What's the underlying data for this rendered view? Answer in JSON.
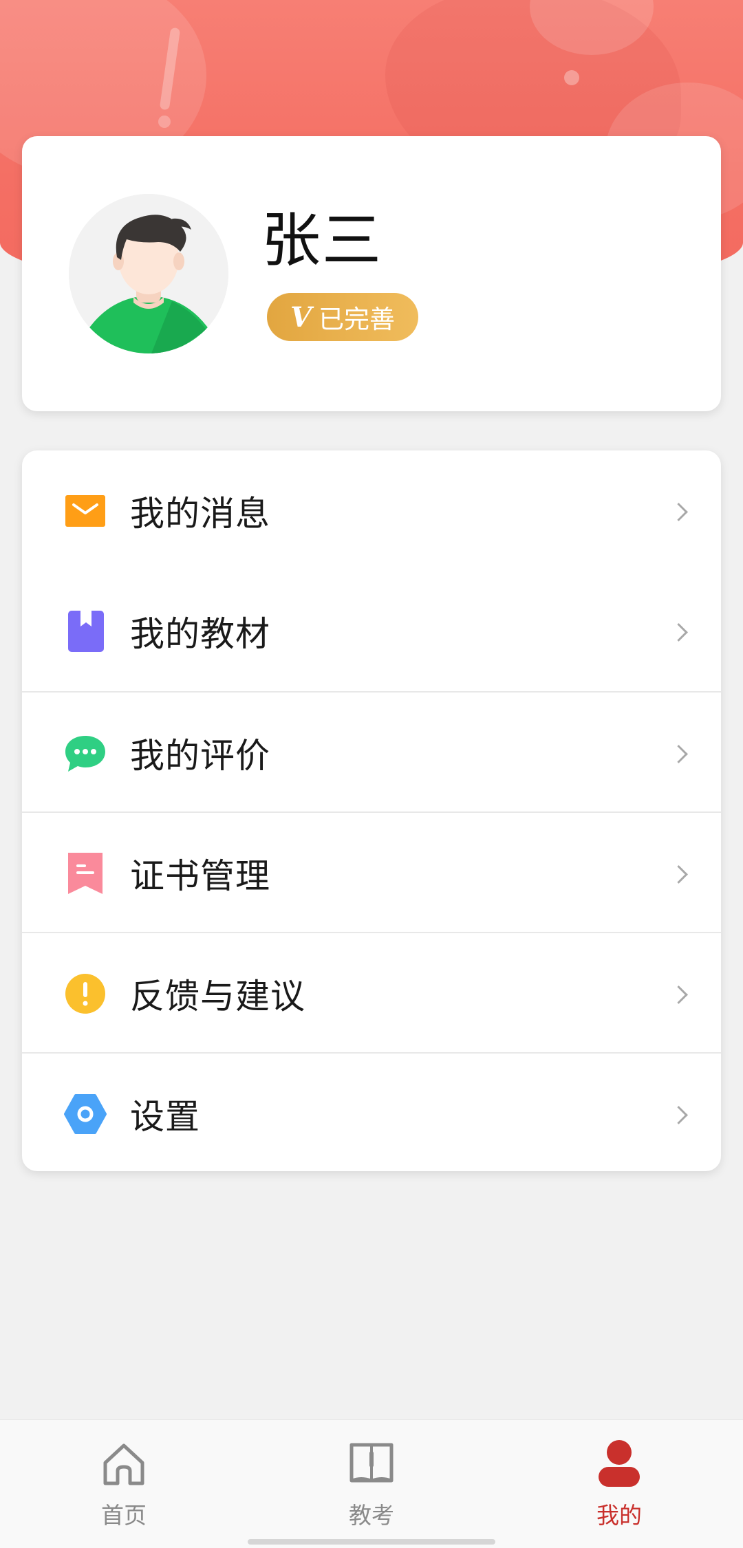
{
  "profile": {
    "name": "张三",
    "badge_prefix": "V",
    "badge_text": "已完善"
  },
  "menu": {
    "items": [
      {
        "label": "我的消息",
        "icon": "mail-icon",
        "color": "#ff9e16"
      },
      {
        "label": "我的教材",
        "icon": "bookmark-book-icon",
        "color": "#7a6cf8"
      },
      {
        "label": "我的评价",
        "icon": "chat-bubble-icon",
        "color": "#2fcf83"
      },
      {
        "label": "证书管理",
        "icon": "certificate-ribbon-icon",
        "color": "#fa8a9b"
      },
      {
        "label": "反馈与建议",
        "icon": "exclamation-circle-icon",
        "color": "#fbc02d"
      },
      {
        "label": "设置",
        "icon": "settings-hexagon-icon",
        "color": "#4aa3f8"
      }
    ]
  },
  "tabbar": {
    "tabs": [
      {
        "label": "首页",
        "icon": "home-icon",
        "active": false
      },
      {
        "label": "教考",
        "icon": "open-book-icon",
        "active": false
      },
      {
        "label": "我的",
        "icon": "person-icon",
        "active": true
      }
    ],
    "active_color": "#c9302c",
    "inactive_color": "#8a8a8a"
  },
  "theme": {
    "header_color": "#f46f64",
    "badge_color": "#e8ad4a"
  }
}
